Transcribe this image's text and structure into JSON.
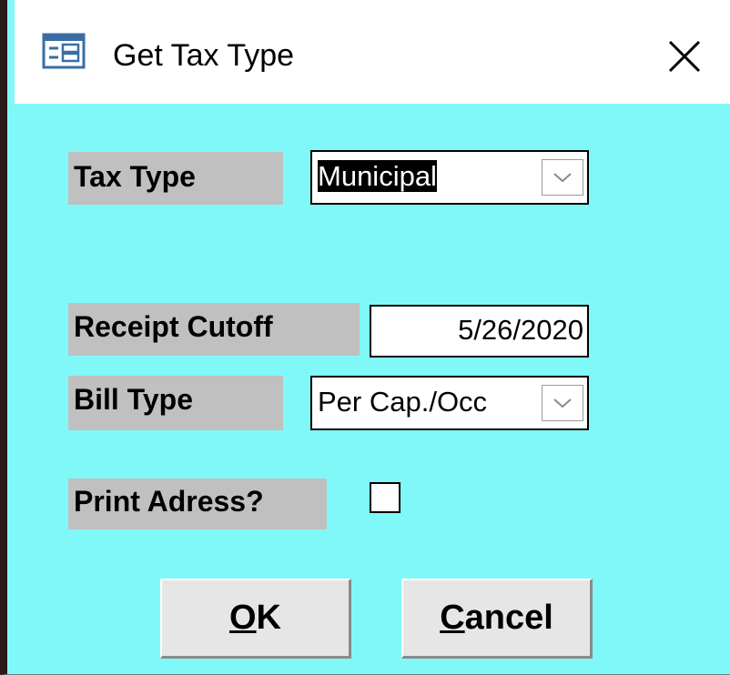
{
  "window": {
    "title": "Get Tax Type",
    "icon": "form-icon",
    "close_icon": "close-icon"
  },
  "form": {
    "tax_type": {
      "label": "Tax Type",
      "value": "Municipal",
      "icon": "chevron-down-icon"
    },
    "receipt_cutoff": {
      "label": "Receipt Cutoff",
      "value": "5/26/2020"
    },
    "bill_type": {
      "label": "Bill Type",
      "value": "Per Cap./Occ",
      "icon": "chevron-down-icon"
    },
    "print_address": {
      "label": "Print Adress?",
      "checked": false
    }
  },
  "buttons": {
    "ok": {
      "mnemonic": "O",
      "rest": "K"
    },
    "cancel": {
      "mnemonic": "C",
      "rest": "ancel"
    }
  },
  "colors": {
    "background": "#80f8f8",
    "label_bg": "#c0c0c0"
  }
}
